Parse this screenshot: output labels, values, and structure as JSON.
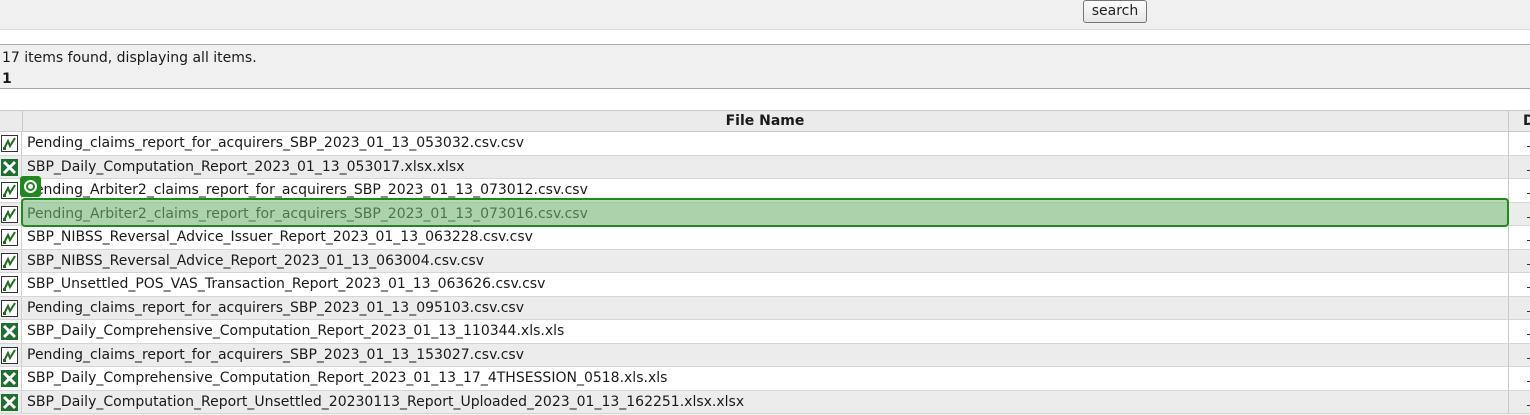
{
  "toolbar": {
    "search_label": "search"
  },
  "results": {
    "summary": "17 items found, displaying all items.",
    "page": "1"
  },
  "table": {
    "columns": [
      "File Name",
      "D"
    ],
    "rows": [
      {
        "name": "Pending_claims_report_for_acquirers_SBP_2023_01_13_053032.csv.csv",
        "type": "csv"
      },
      {
        "name": "SBP_Daily_Computation_Report_2023_01_13_053017.xlsx.xlsx",
        "type": "excel"
      },
      {
        "name": "Pending_Arbiter2_claims_report_for_acquirers_SBP_2023_01_13_073012.csv.csv",
        "type": "csv"
      },
      {
        "name": "Pending_Arbiter2_claims_report_for_acquirers_SBP_2023_01_13_073016.csv.csv",
        "type": "csv"
      },
      {
        "name": "SBP_NIBSS_Reversal_Advice_Issuer_Report_2023_01_13_063228.csv.csv",
        "type": "csv"
      },
      {
        "name": "SBP_NIBSS_Reversal_Advice_Report_2023_01_13_063004.csv.csv",
        "type": "csv"
      },
      {
        "name": "SBP_Unsettled_POS_VAS_Transaction_Report_2023_01_13_063626.csv.csv",
        "type": "csv"
      },
      {
        "name": "Pending_claims_report_for_acquirers_SBP_2023_01_13_095103.csv.csv",
        "type": "csv"
      },
      {
        "name": "SBP_Daily_Comprehensive_Computation_Report_2023_01_13_110344.xls.xls",
        "type": "excel"
      },
      {
        "name": "Pending_claims_report_for_acquirers_SBP_2023_01_13_153027.csv.csv",
        "type": "csv"
      },
      {
        "name": "SBP_Daily_Comprehensive_Computation_Report_2023_01_13_17_4THSESSION_0518.xls.xls",
        "type": "excel"
      },
      {
        "name": "SBP_Daily_Computation_Report_Unsettled_20230113_Report_Uploaded_2023_01_13_162251.xlsx.xlsx",
        "type": "excel"
      }
    ],
    "highlighted_row": 3
  },
  "icons": {
    "csv": "csv-file-icon",
    "excel": "excel-file-icon",
    "cursor": "target-cursor-icon"
  },
  "colors": {
    "highlight_fill": "#a8d0a8",
    "highlight_border": "#1e8a1e",
    "row_alt": "#ececec"
  }
}
